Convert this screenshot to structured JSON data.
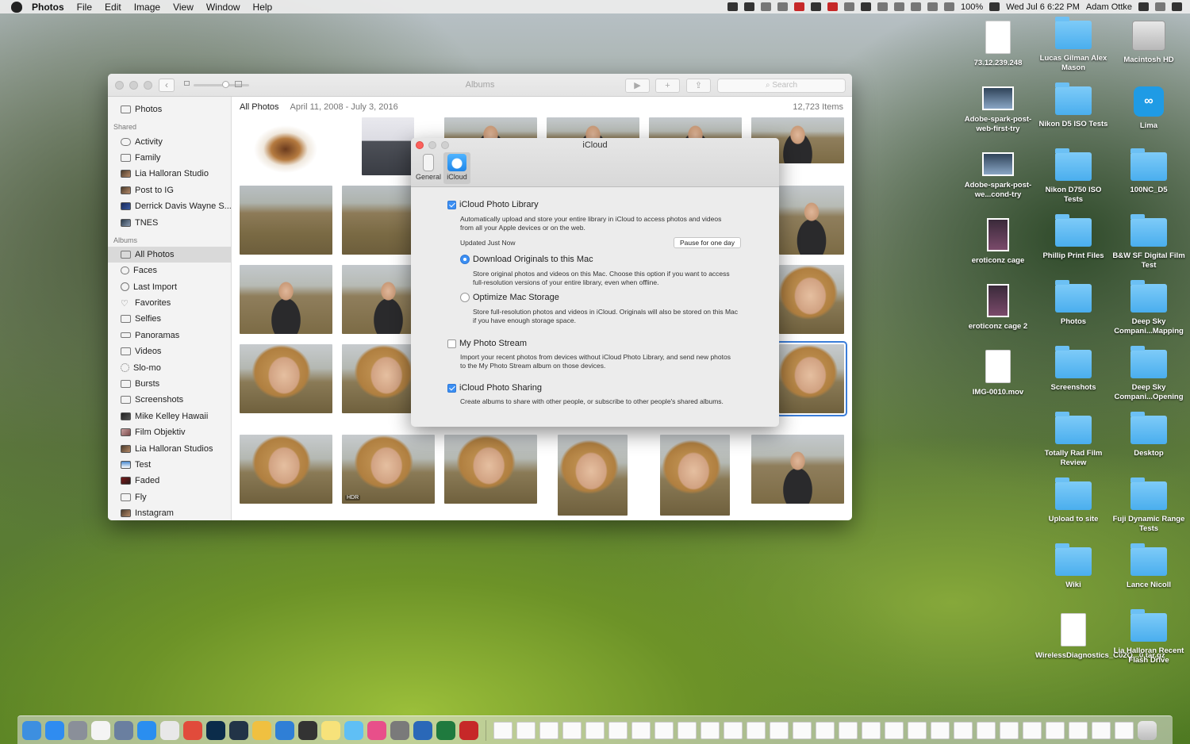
{
  "menubar": {
    "app_name": "Photos",
    "items": [
      "File",
      "Edit",
      "Image",
      "View",
      "Window",
      "Help"
    ],
    "battery": "100%",
    "datetime": "Wed Jul 6  6:22 PM",
    "user": "Adam Ottke"
  },
  "window": {
    "title": "Albums",
    "search_placeholder": "Search",
    "header": {
      "title": "All Photos",
      "dates": "April 11, 2008 - July 3, 2016",
      "count": "12,723 Items"
    },
    "sidebar": {
      "top": [
        {
          "label": "Photos",
          "icon": "photos-icon"
        }
      ],
      "shared_heading": "Shared",
      "shared": [
        {
          "label": "Activity",
          "icon": "cloud-icon"
        },
        {
          "label": "Family",
          "icon": "album-icon"
        },
        {
          "label": "Lia Halloran Studio",
          "icon": "album-thumb-icon"
        },
        {
          "label": "Post to IG",
          "icon": "album-thumb-icon"
        },
        {
          "label": "Derrick Davis Wayne S...",
          "icon": "album-thumb-icon"
        },
        {
          "label": "TNES",
          "icon": "album-thumb-icon"
        }
      ],
      "albums_heading": "Albums",
      "albums": [
        {
          "label": "All Photos",
          "icon": "album-icon",
          "selected": true
        },
        {
          "label": "Faces",
          "icon": "faces-icon"
        },
        {
          "label": "Last Import",
          "icon": "clock-icon"
        },
        {
          "label": "Favorites",
          "icon": "heart-icon"
        },
        {
          "label": "Selfies",
          "icon": "camera-icon"
        },
        {
          "label": "Panoramas",
          "icon": "panorama-icon"
        },
        {
          "label": "Videos",
          "icon": "video-icon"
        },
        {
          "label": "Slo-mo",
          "icon": "slomo-icon"
        },
        {
          "label": "Bursts",
          "icon": "bursts-icon"
        },
        {
          "label": "Screenshots",
          "icon": "screenshot-icon"
        },
        {
          "label": "Mike Kelley Hawaii",
          "icon": "album-thumb-icon"
        },
        {
          "label": "Film Objektiv",
          "icon": "album-thumb-icon"
        },
        {
          "label": "Lia Halloran Studios",
          "icon": "album-thumb-icon"
        },
        {
          "label": "Test",
          "icon": "album-thumb-icon"
        },
        {
          "label": "Faded",
          "icon": "album-thumb-icon"
        },
        {
          "label": "Fly",
          "icon": "album-icon"
        },
        {
          "label": "Instagram",
          "icon": "album-thumb-icon"
        }
      ]
    },
    "hdr_badge": "HDR"
  },
  "prefs": {
    "title": "iCloud",
    "tabs": [
      {
        "label": "General"
      },
      {
        "label": "iCloud"
      }
    ],
    "photo_library": {
      "label": "iCloud Photo Library",
      "checked": true,
      "description": "Automatically upload and store your entire library in iCloud to access photos and videos from all your Apple devices or on the web.",
      "status": "Updated Just Now",
      "pause_button": "Pause for one day"
    },
    "download_originals": {
      "label": "Download Originals to this Mac",
      "selected": true,
      "description": "Store original photos and videos on this Mac. Choose this option if you want to access full-resolution versions of your entire library, even when offline."
    },
    "optimize_storage": {
      "label": "Optimize Mac Storage",
      "selected": false,
      "description": "Store full-resolution photos and videos in iCloud. Originals will also be stored on this Mac if you have enough storage space."
    },
    "photo_stream": {
      "label": "My Photo Stream",
      "checked": false,
      "description": "Import your recent photos from devices without iCloud Photo Library, and send new photos to the My Photo Stream album on those devices."
    },
    "photo_sharing": {
      "label": "iCloud Photo Sharing",
      "checked": true,
      "description": "Create albums to share with other people, or subscribe to other people's shared albums."
    }
  },
  "desktop": {
    "icons": [
      {
        "label": "73.12.239.248",
        "kind": "doc"
      },
      {
        "label": "Lucas Gilman Alex Mason",
        "kind": "folder"
      },
      {
        "label": "Macintosh HD",
        "kind": "drive"
      },
      {
        "label": "Adobe-spark-post-web-first-try",
        "kind": "image"
      },
      {
        "label": "Nikon D5 ISO Tests",
        "kind": "folder"
      },
      {
        "label": "Lima",
        "kind": "app"
      },
      {
        "label": "Adobe-spark-post-we...cond-try",
        "kind": "image"
      },
      {
        "label": "Nikon D750 ISO Tests",
        "kind": "folder"
      },
      {
        "label": "100NC_D5",
        "kind": "folder"
      },
      {
        "label": "eroticonz cage",
        "kind": "tall-image"
      },
      {
        "label": "Phillip Print Files",
        "kind": "folder"
      },
      {
        "label": "B&W SF Digital Film Test",
        "kind": "folder"
      },
      {
        "label": "eroticonz cage 2",
        "kind": "tall-image"
      },
      {
        "label": "Photos",
        "kind": "folder"
      },
      {
        "label": "Deep Sky Compani...Mapping",
        "kind": "folder"
      },
      {
        "label": "IMG-0010.mov",
        "kind": "doc"
      },
      {
        "label": "Screenshots",
        "kind": "folder"
      },
      {
        "label": "Deep Sky Compani...Opening",
        "kind": "folder"
      },
      {
        "label": "Totally Rad Film Review",
        "kind": "folder"
      },
      {
        "label": "Desktop",
        "kind": "folder"
      },
      {
        "label": "Upload to site",
        "kind": "folder"
      },
      {
        "label": "Fuji Dynamic Range Tests",
        "kind": "folder"
      },
      {
        "label": "Wiki",
        "kind": "folder"
      },
      {
        "label": "Lance Nicoll",
        "kind": "folder"
      },
      {
        "label": "WirelessDiagnostics_C02Q...0.tar.gz",
        "kind": "doc"
      },
      {
        "label": "Lia Halloran Recent Flash Drive",
        "kind": "folder"
      }
    ]
  },
  "dock": {
    "apps": [
      {
        "name": "finder-icon",
        "color": "#3d8fe0"
      },
      {
        "name": "app-store-icon",
        "color": "#2f8cf0"
      },
      {
        "name": "launchpad-icon",
        "color": "#8a8f99"
      },
      {
        "name": "calendar-icon",
        "color": "#f4f4f4"
      },
      {
        "name": "photos-app-icon",
        "color": "#6a7fa0"
      },
      {
        "name": "safari-icon",
        "color": "#2a8ef0"
      },
      {
        "name": "slack-icon",
        "color": "#e8e8e8"
      },
      {
        "name": "chrome-icon",
        "color": "#e14b3b"
      },
      {
        "name": "photoshop-icon",
        "color": "#0b2c4a"
      },
      {
        "name": "lightroom-icon",
        "color": "#223447"
      },
      {
        "name": "photos-icon",
        "color": "#f0c040"
      },
      {
        "name": "1password-icon",
        "color": "#2f7fd6"
      },
      {
        "name": "capture-one-icon",
        "color": "#333333"
      },
      {
        "name": "notes-icon",
        "color": "#f7e27a"
      },
      {
        "name": "messages-icon",
        "color": "#5fbff5"
      },
      {
        "name": "itunes-icon",
        "color": "#e84f8a"
      },
      {
        "name": "system-preferences-icon",
        "color": "#7a7a7a"
      },
      {
        "name": "word-icon",
        "color": "#2a68b8"
      },
      {
        "name": "excel-icon",
        "color": "#1f7a3e"
      },
      {
        "name": "stuff-icon",
        "color": "#c62828"
      }
    ]
  }
}
